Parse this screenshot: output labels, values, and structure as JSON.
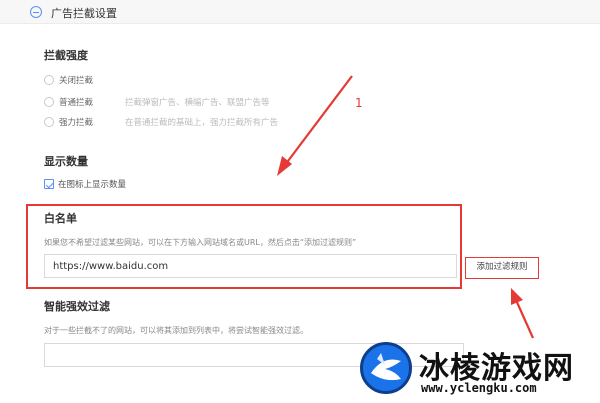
{
  "header": {
    "title": "广告拦截设置"
  },
  "block_strength": {
    "title": "拦截强度",
    "options": [
      {
        "label": "关闭拦截",
        "desc": ""
      },
      {
        "label": "普通拦截",
        "desc": "拦截弹窗广告、横幅广告、联盟广告等"
      },
      {
        "label": "强力拦截",
        "desc": "在普通拦截的基础上，强力拦截所有广告"
      }
    ]
  },
  "display_count": {
    "title": "显示数量",
    "checkbox_label": "在图标上显示数量",
    "checked": true
  },
  "whitelist": {
    "title": "白名单",
    "desc": "如果您不希望过滤某些网站，可以在下方输入网站域名或URL，然后点击“添加过滤规则”",
    "input_value": "https://www.baidu.com",
    "add_button": "添加过滤规则"
  },
  "smart_filter": {
    "title": "智能强效过滤",
    "desc": "对于一些拦截不了的网站，可以将其添加到列表中，将尝试智能强效过滤。",
    "input_value": ""
  },
  "annotation": {
    "number": "1",
    "color": "#e53935"
  },
  "watermark": {
    "title": "冰棱游戏网",
    "url": "www.yclengku.com"
  },
  "colors": {
    "accent": "#5b8ff9",
    "highlight": "#e53935"
  }
}
